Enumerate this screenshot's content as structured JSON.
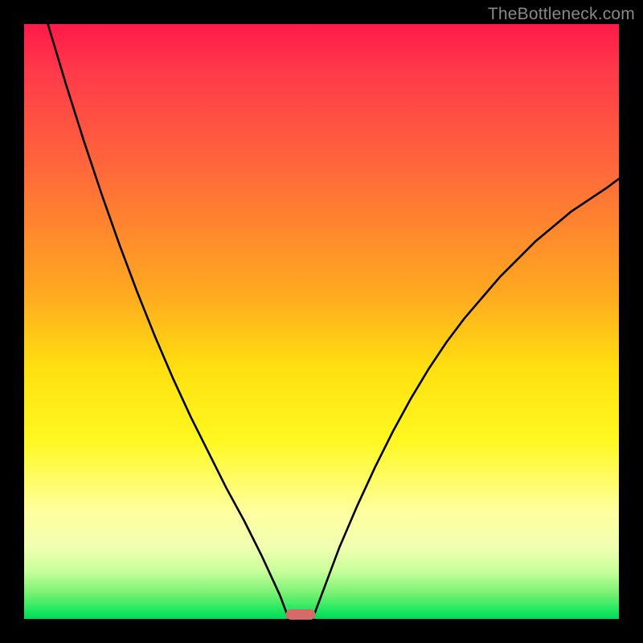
{
  "watermark": "TheBottleneck.com",
  "colors": {
    "frame": "#000000",
    "gradient_top": "#ff1a4a",
    "gradient_bottom": "#00d858",
    "curve": "#000000",
    "marker": "#d66a6a",
    "watermark_text": "#888888"
  },
  "chart_data": {
    "type": "line",
    "title": "",
    "xlabel": "",
    "ylabel": "",
    "xlim": [
      0,
      100
    ],
    "ylim": [
      0,
      100
    ],
    "grid": false,
    "legend": false,
    "background": "vertical-gradient red→orange→yellow→green",
    "annotations": [
      {
        "type": "rounded-bar",
        "x_center": 46.5,
        "y": 0,
        "width": 5,
        "color": "#d66a6a",
        "meaning": "optimal / no-bottleneck point"
      }
    ],
    "series": [
      {
        "name": "left-branch",
        "x": [
          4,
          7,
          10,
          13,
          16,
          19,
          22,
          25,
          28,
          31,
          34,
          37,
          40,
          43,
          44.5
        ],
        "y": [
          100,
          90,
          80.5,
          71.5,
          63,
          55,
          47.5,
          40.5,
          34,
          28,
          22,
          16.5,
          10.5,
          4,
          0
        ]
      },
      {
        "name": "right-branch",
        "x": [
          48.5,
          50,
          53,
          56,
          59,
          62,
          65,
          68,
          71,
          74,
          77,
          80,
          83,
          86,
          89,
          92,
          95,
          98,
          100
        ],
        "y": [
          0,
          4,
          12,
          19,
          25.5,
          31.5,
          37,
          42,
          46.5,
          50.5,
          54,
          57.5,
          60.5,
          63.5,
          66,
          68.5,
          70.5,
          72.5,
          74
        ]
      }
    ]
  }
}
